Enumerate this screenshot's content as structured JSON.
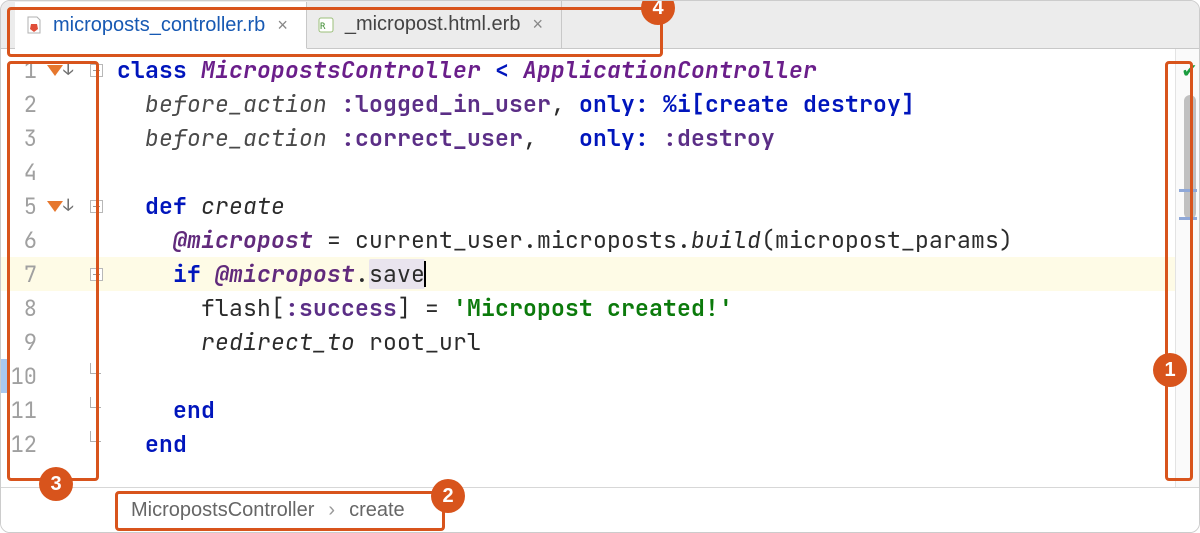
{
  "tabs": [
    {
      "label": "microposts_controller.rb",
      "icon": "ruby",
      "active": true
    },
    {
      "label": "_micropost.html.erb",
      "icon": "erb",
      "active": false
    }
  ],
  "gutter": {
    "lines": [
      {
        "n": "1",
        "vcs": true,
        "fold": "open"
      },
      {
        "n": "2"
      },
      {
        "n": "3"
      },
      {
        "n": "4"
      },
      {
        "n": "5",
        "vcs": true,
        "fold": "open"
      },
      {
        "n": "6"
      },
      {
        "n": "7",
        "current": true,
        "fold": "open"
      },
      {
        "n": "8"
      },
      {
        "n": "9"
      },
      {
        "n": "10",
        "fold": "end"
      },
      {
        "n": "11",
        "fold": "end"
      },
      {
        "n": "12",
        "fold": "end"
      }
    ]
  },
  "code": {
    "l1": {
      "kw1": "class ",
      "cls1": "MicropostsController",
      "op": " < ",
      "cls2": "ApplicationController"
    },
    "l2": {
      "pad": "  ",
      "fn": "before_action ",
      "sym1": ":logged_in_user",
      "mid": ", ",
      "kw": "only: ",
      "rest": "%i[create destroy]"
    },
    "l3": {
      "pad": "  ",
      "fn": "before_action ",
      "sym1": ":correct_user",
      "mid": ",   ",
      "kw": "only: ",
      "sym2": ":destroy"
    },
    "l4": {
      "pad": ""
    },
    "l5": {
      "pad": "  ",
      "kw": "def ",
      "name": "create"
    },
    "l6": {
      "pad": "    ",
      "ivar": "@micropost",
      "eq": " = current_user.microposts.",
      "fn": "build",
      "rest": "(micropost_params)"
    },
    "l7": {
      "pad": "    ",
      "kw": "if ",
      "ivar": "@micropost",
      "dot": ".",
      "call": "save"
    },
    "l8": {
      "pad": "      ",
      "a": "flash[",
      "sym": ":success",
      "b": "] = ",
      "str": "'Micropost created!'"
    },
    "l9": {
      "pad": "      ",
      "fn": "redirect_to",
      "rest": " root_url"
    },
    "l10": {
      "pad": ""
    },
    "l11": {
      "pad": "    ",
      "kw": "end"
    },
    "l12": {
      "pad": "  ",
      "kw": "end"
    }
  },
  "breadcrumb": {
    "a": "MicropostsController",
    "b": "create",
    "sep": "›"
  },
  "callouts": {
    "c1": "1",
    "c2": "2",
    "c3": "3",
    "c4": "4"
  },
  "status": {
    "inspection": "ok"
  }
}
